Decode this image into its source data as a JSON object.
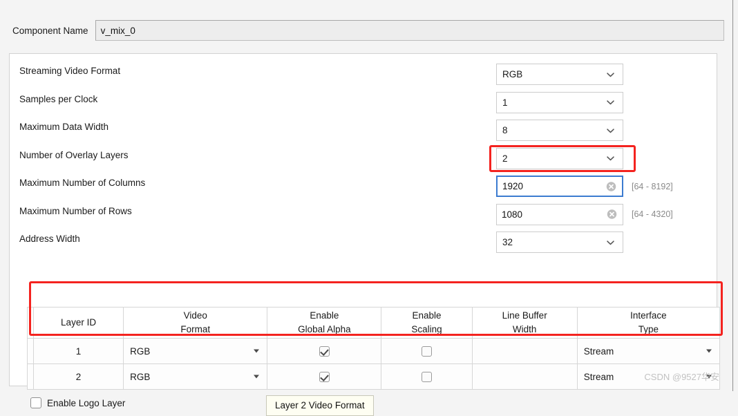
{
  "component": {
    "label": "Component Name",
    "value": "v_mix_0",
    "placeholder": ""
  },
  "options": [
    {
      "label": "Streaming Video Format",
      "type": "combo",
      "value": "RGB",
      "icon": "chevron-down-icon",
      "name": "streaming-video-format"
    },
    {
      "label": "Samples per Clock",
      "type": "combo",
      "value": "1",
      "icon": "chevron-down-icon",
      "name": "samples-per-clock"
    },
    {
      "label": "Maximum Data Width",
      "type": "combo",
      "value": "8",
      "icon": "chevron-down-icon",
      "name": "maximum-data-width"
    },
    {
      "label": "Number of Overlay Layers",
      "type": "combo",
      "value": "2",
      "icon": "chevron-down-icon",
      "name": "number-of-overlay-layers",
      "highlighted": true
    },
    {
      "label": "Maximum Number of Columns",
      "type": "text",
      "value": "1920",
      "hint": "[64 - 8192]",
      "icon": "clear-circle-icon",
      "focused": true,
      "name": "maximum-number-of-columns"
    },
    {
      "label": "Maximum Number of Rows",
      "type": "text",
      "value": "1080",
      "hint": "[64 - 4320]",
      "icon": "clear-circle-icon",
      "focused": false,
      "name": "maximum-number-of-rows"
    },
    {
      "label": "Address Width",
      "type": "combo",
      "value": "32",
      "icon": "chevron-down-icon",
      "name": "address-width"
    }
  ],
  "table": {
    "headers": [
      {
        "line1": "",
        "line2": ""
      },
      {
        "line1": "Layer ID",
        "line2": ""
      },
      {
        "line1": "Video",
        "line2": "Format"
      },
      {
        "line1": "Enable",
        "line2": "Global Alpha"
      },
      {
        "line1": "Enable",
        "line2": "Scaling"
      },
      {
        "line1": "Line Buffer",
        "line2": "Width"
      },
      {
        "line1": "Interface",
        "line2": "Type"
      }
    ],
    "rows": [
      {
        "layer_id": "1",
        "video_format": "RGB",
        "enable_global_alpha": true,
        "enable_scaling": false,
        "line_buffer_width": "",
        "interface_type": "Stream"
      },
      {
        "layer_id": "2",
        "video_format": "RGB",
        "enable_global_alpha": true,
        "enable_scaling": false,
        "line_buffer_width": "",
        "interface_type": "Stream"
      }
    ]
  },
  "enable_logo_layer": {
    "label": "Enable Logo Layer",
    "checked": false
  },
  "tooltip": {
    "text": "Layer 2 Video Format"
  },
  "watermark": {
    "text": "CSDN @9527华安"
  },
  "colors": {
    "highlight": "#f4231f",
    "focus_border": "#3b7bd0",
    "panel_bg": "#ffffff",
    "window_bg": "#f4f4f4",
    "tooltip_bg": "#fefef2"
  }
}
